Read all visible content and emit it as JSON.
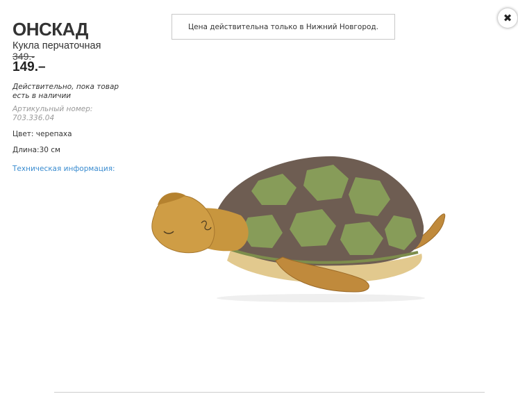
{
  "product": {
    "name": "ОНСКАД",
    "type": "Кукла перчаточная",
    "old_price": "349.-",
    "price": "149.–",
    "validity": "Действительно, пока товар есть в наличии",
    "article": "Артикульный номер: 703.336.04",
    "color": "Цвет: черепаха",
    "length": "Длина:30 см",
    "tech_info_link": "Техническая информация:"
  },
  "notice": {
    "text": "Цена действительна только в Нижний Новгород."
  },
  "close": {
    "icon": "close-icon",
    "glyph": "✖"
  },
  "image": {
    "subject": "turtle-plush-puppet",
    "colors": {
      "shell_dark": "#6e5d52",
      "shell_light": "#8aa35a",
      "skin": "#c8963e",
      "belly": "#e0c88c"
    }
  }
}
